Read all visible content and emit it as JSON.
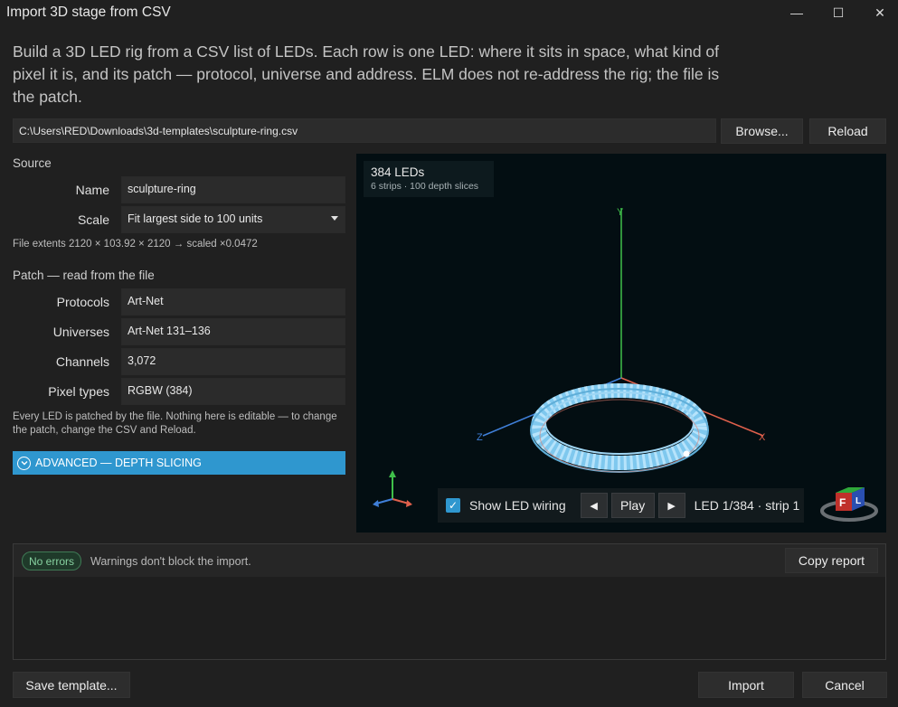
{
  "window": {
    "title": "Import 3D stage from CSV",
    "minimize_glyph": "—",
    "maximize_glyph": "☐",
    "close_glyph": "✕"
  },
  "intro": "Build a 3D LED rig from a CSV list of LEDs. Each row is one LED: where it sits in space, what kind of pixel it is, and its patch — protocol, universe and address. ELM does not re-address the rig; the file is the patch.",
  "file": {
    "path": "C:\\Users\\RED\\Downloads\\3d-templates\\sculpture-ring.csv",
    "browse_label": "Browse...",
    "reload_label": "Reload"
  },
  "source": {
    "section_title": "Source",
    "name_label": "Name",
    "name_value": "sculpture-ring",
    "scale_label": "Scale",
    "scale_value": "Fit largest side to 100 units",
    "extents": "File extents 2120 × 103.92 × 2120 → scaled ×0.0472"
  },
  "patch": {
    "section_title": "Patch — read from the file",
    "protocols_label": "Protocols",
    "protocols_value": "Art-Net",
    "universes_label": "Universes",
    "universes_value": "Art-Net 131–136",
    "channels_label": "Channels",
    "channels_value": "3,072",
    "pixel_types_label": "Pixel types",
    "pixel_types_value": "RGBW (384)",
    "note": "Every LED is patched by the file. Nothing here is editable — to change the patch, change the CSV and Reload."
  },
  "advanced": {
    "label": "ADVANCED — DEPTH SLICING"
  },
  "viewport": {
    "led_count": "384 LEDs",
    "led_detail": "6 strips · 100 depth slices",
    "axis_x": "X",
    "axis_y": "Y",
    "axis_z": "Z",
    "cube_faces": [
      "F",
      "L"
    ],
    "show_wiring_label": "Show LED wiring",
    "show_wiring_checked": true,
    "play_label": "Play",
    "prev_glyph": "◀",
    "next_glyph": "▶",
    "led_position": "LED 1/384 · strip 1"
  },
  "report": {
    "status_badge": "No errors",
    "warning_text": "Warnings don't block the import.",
    "copy_label": "Copy report"
  },
  "footer": {
    "save_template_label": "Save template...",
    "import_label": "Import",
    "cancel_label": "Cancel"
  },
  "colors": {
    "accent": "#2f97cf",
    "viewport_bg": "#030e12",
    "ring": "#7fc8ee",
    "axis_x": "#e0604c",
    "axis_y": "#3fbf4a",
    "axis_z": "#3f7fd8",
    "ok_green": "#87d1a0"
  }
}
